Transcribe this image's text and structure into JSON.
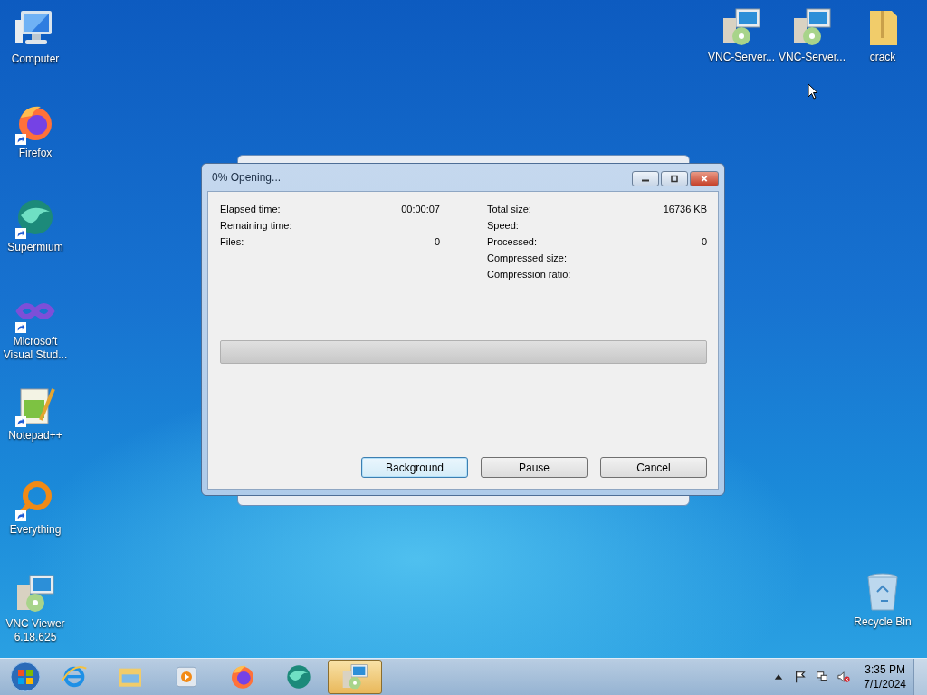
{
  "desktop_left": [
    {
      "kind": "computer",
      "label": "Computer",
      "shortcut": false
    },
    {
      "kind": "firefox",
      "label": "Firefox",
      "shortcut": true
    },
    {
      "kind": "supermium",
      "label": "Supermium",
      "shortcut": true
    },
    {
      "kind": "vstudio",
      "label": "Microsoft Visual Stud...",
      "shortcut": true
    },
    {
      "kind": "notepad",
      "label": "Notepad++",
      "shortcut": true
    },
    {
      "kind": "everything",
      "label": "Everything",
      "shortcut": true
    },
    {
      "kind": "installer",
      "label": "VNC Viewer 6.18.625",
      "shortcut": false
    }
  ],
  "desktop_right": [
    {
      "kind": "installer",
      "label": "VNC-Server...",
      "shortcut": false
    },
    {
      "kind": "installer",
      "label": "VNC-Server...",
      "shortcut": false
    },
    {
      "kind": "zipfolder",
      "label": "crack",
      "shortcut": false
    }
  ],
  "recycle_bin": {
    "label": "Recycle Bin"
  },
  "dialog": {
    "title": "0% Opening...",
    "left_stats": [
      {
        "label": "Elapsed time:",
        "value": "00:00:07"
      },
      {
        "label": "Remaining time:"
      },
      {
        "label": "Files:",
        "value": "0"
      }
    ],
    "right_stats": [
      {
        "label": "Total size:",
        "value": "16736 KB"
      },
      {
        "label": "Speed:"
      },
      {
        "label": "Processed:",
        "value": "0"
      },
      {
        "label": "Compressed size:"
      },
      {
        "label": "Compression ratio:"
      }
    ],
    "progress": {
      "level": 0
    },
    "buttons": [
      {
        "label": "Background",
        "focused": true
      },
      {
        "label": "Pause",
        "focused": false
      },
      {
        "label": "Cancel",
        "focused": false
      }
    ]
  },
  "taskbar": {
    "items": [
      {
        "kind": "ie",
        "active": false
      },
      {
        "kind": "explorer",
        "active": false
      },
      {
        "kind": "media",
        "active": false
      },
      {
        "kind": "firefox",
        "active": false
      },
      {
        "kind": "supermium",
        "active": false
      },
      {
        "kind": "installer",
        "active": true
      }
    ],
    "clock": {
      "time": "3:35 PM",
      "date": "7/1/2024"
    }
  }
}
